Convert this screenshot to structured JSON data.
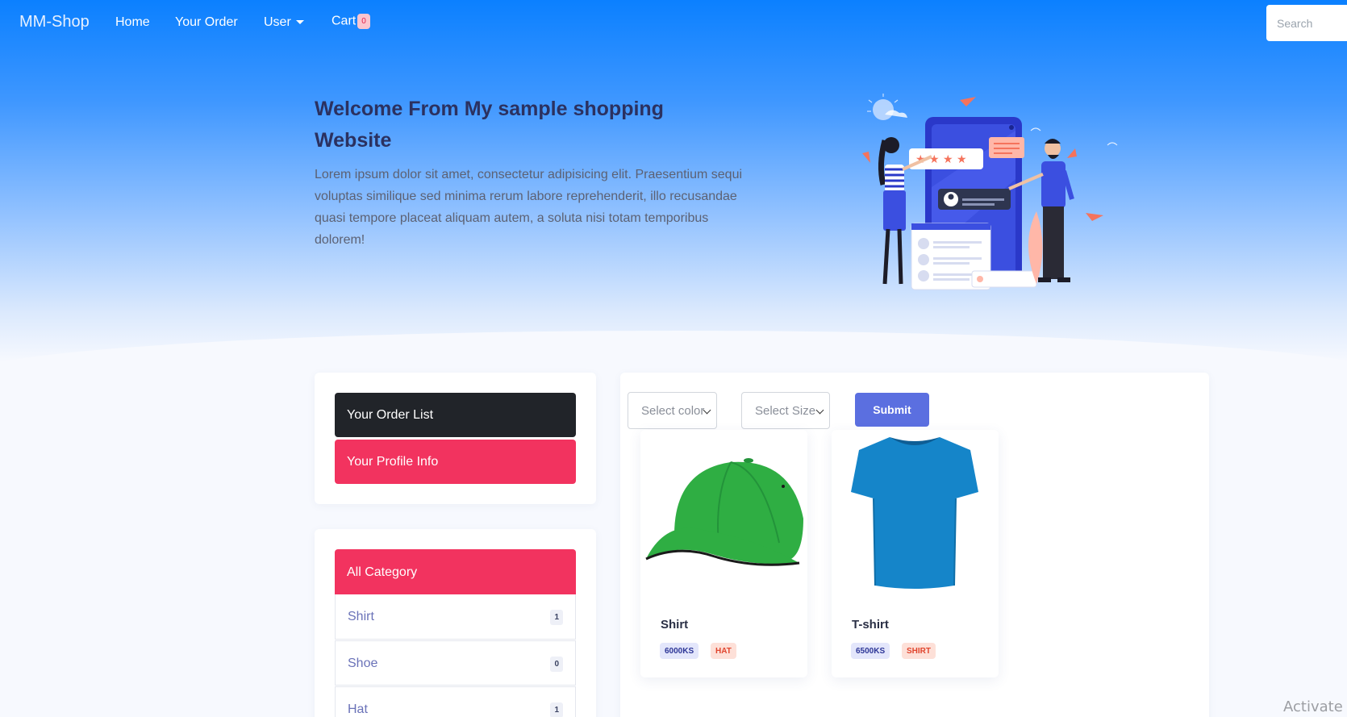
{
  "nav": {
    "brand": "MM-Shop",
    "links": [
      "Home",
      "Your Order",
      "User",
      "Cart"
    ],
    "cart_count": "0",
    "search_placeholder": "Search"
  },
  "hero": {
    "title": "Welcome From My sample shopping Website",
    "text": "Lorem ipsum dolor sit amet, consectetur adipisicing elit. Praesentium sequi voluptas similique sed minima rerum labore reprehenderit, illo recusandae quasi tempore placeat aliquam autem, a soluta nisi totam temporibus dolorem!"
  },
  "account_panel": {
    "order_list": "Your Order List",
    "profile_info": "Your Profile Info"
  },
  "category_panel": {
    "header": "All Category",
    "items": [
      {
        "label": "Shirt",
        "count": "1"
      },
      {
        "label": "Shoe",
        "count": "0"
      },
      {
        "label": "Hat",
        "count": "1"
      }
    ]
  },
  "filters": {
    "color_select": "Select color",
    "size_select": "Select Size",
    "submit": "Submit"
  },
  "products": [
    {
      "name": "Shirt",
      "price": "6000KS",
      "tag": "HAT",
      "image": "green-cap-icon"
    },
    {
      "name": "T-shirt",
      "price": "6500KS",
      "tag": "SHIRT",
      "image": "blue-tshirt-icon"
    }
  ],
  "watermark": "Activate W",
  "colors": {
    "nav_bg": "#0b80ff",
    "dark_button": "#212429",
    "pink": "#f2335f",
    "submit": "#5b6fe0"
  }
}
